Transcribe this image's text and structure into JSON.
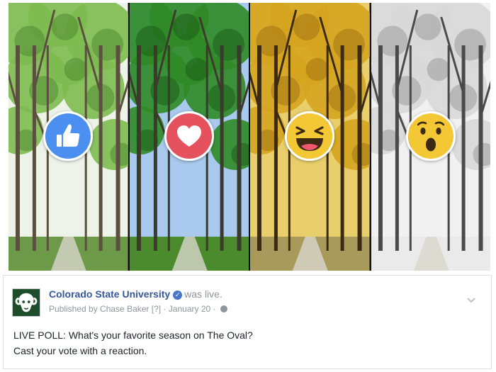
{
  "photos": {
    "panels": [
      {
        "season": "spring",
        "reaction": "like-icon",
        "sky": "#eef3ea",
        "foliage": "#7dbb50",
        "foliage_dark": "#4f8a30",
        "trunk": "#5b5040",
        "ground": "#6c9a48"
      },
      {
        "season": "summer",
        "reaction": "love-icon",
        "sky": "#a9c9ee",
        "foliage": "#2f8a26",
        "foliage_dark": "#1d5c17",
        "trunk": "#3c3a2c",
        "ground": "#4c8a2e"
      },
      {
        "season": "fall",
        "reaction": "haha-icon",
        "sky": "#e8cf6c",
        "foliage": "#d5a420",
        "foliage_dark": "#a27412",
        "trunk": "#3a2a14",
        "ground": "#a79a5a"
      },
      {
        "season": "winter",
        "reaction": "wow-icon",
        "sky": "#f1f1f1",
        "foliage": "#d8d8d8",
        "foliage_dark": "#9a9a9a",
        "trunk": "#4a4a4a",
        "ground": "#eaeaea"
      }
    ],
    "reaction_colors": {
      "like": "#4b8ff0",
      "love": "#e5525e",
      "haha": "#f4c734",
      "wow": "#f4c734"
    }
  },
  "post": {
    "page_name": "Colorado State University",
    "verified_icon": "verified-badge-icon",
    "status_text": "was live.",
    "published_by": "Published by Chase Baker",
    "help_marker": "[?]",
    "separator": "·",
    "date": "January 20",
    "privacy_icon": "globe-icon",
    "menu_icon": "chevron-down-icon",
    "body_lines": [
      "LIVE POLL: What's your favorite season on The Oval?",
      "Cast your vote with a reaction."
    ]
  }
}
